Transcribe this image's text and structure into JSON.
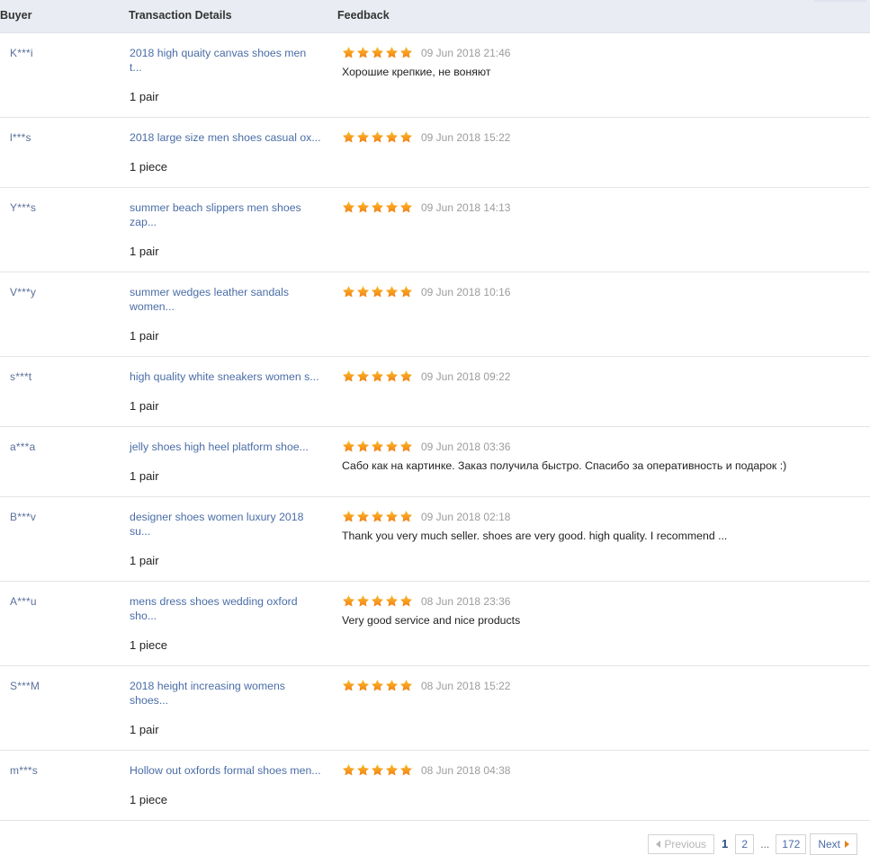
{
  "table": {
    "columns": [
      {
        "key": "buyer",
        "label": "Buyer"
      },
      {
        "key": "transaction",
        "label": "Transaction Details"
      },
      {
        "key": "feedback",
        "label": "Feedback"
      }
    ],
    "rows": [
      {
        "buyer": "K***i",
        "product": "2018 high quaity canvas shoes men t...",
        "quantity": "1 pair",
        "rating": 5,
        "date": "09 Jun 2018 21:46",
        "comment": "Хорошие крепкие, не воняют"
      },
      {
        "buyer": "l***s",
        "product": "2018 large size men shoes casual ox...",
        "quantity": "1 piece",
        "rating": 5,
        "date": "09 Jun 2018 15:22",
        "comment": ""
      },
      {
        "buyer": "Y***s",
        "product": "summer beach slippers men shoes zap...",
        "quantity": "1 pair",
        "rating": 5,
        "date": "09 Jun 2018 14:13",
        "comment": ""
      },
      {
        "buyer": "V***y",
        "product": "summer wedges leather sandals women...",
        "quantity": "1 pair",
        "rating": 5,
        "date": "09 Jun 2018 10:16",
        "comment": ""
      },
      {
        "buyer": "s***t",
        "product": "high quality white sneakers women s...",
        "quantity": "1 pair",
        "rating": 5,
        "date": "09 Jun 2018 09:22",
        "comment": ""
      },
      {
        "buyer": "a***a",
        "product": "jelly shoes high heel platform shoe...",
        "quantity": "1 pair",
        "rating": 5,
        "date": "09 Jun 2018 03:36",
        "comment": "Сабо как на картинке. Заказ получила быстро. Спасибо за оперативность и подарок :)"
      },
      {
        "buyer": "B***v",
        "product": "designer shoes women luxury 2018 su...",
        "quantity": "1 pair",
        "rating": 5,
        "date": "09 Jun 2018 02:18",
        "comment": "Thank you very much seller. shoes are very good. high quality. I recommend ..."
      },
      {
        "buyer": "A***u",
        "product": "mens dress shoes wedding oxford sho...",
        "quantity": "1 piece",
        "rating": 5,
        "date": "08 Jun 2018 23:36",
        "comment": "Very good service and nice products"
      },
      {
        "buyer": "S***M",
        "product": "2018 height increasing womens shoes...",
        "quantity": "1 pair",
        "rating": 5,
        "date": "08 Jun 2018 15:22",
        "comment": ""
      },
      {
        "buyer": "m***s",
        "product": "Hollow out oxfords formal shoes men...",
        "quantity": "1 piece",
        "rating": 5,
        "date": "08 Jun 2018 04:38",
        "comment": ""
      }
    ]
  },
  "pagination": {
    "previous_label": "Previous",
    "next_label": "Next",
    "ellipsis": "...",
    "pages": [
      "1",
      "2"
    ],
    "last_page": "172",
    "current_page": "1"
  },
  "colors": {
    "header_bg": "#e9ecf2",
    "link": "#4a6da7",
    "star": "#f5a623",
    "date": "#9c9c9c",
    "row_border": "#e4e4e4"
  },
  "icons": {
    "star": "star-icon",
    "prev_arrow": "triangle-left-icon",
    "next_arrow": "triangle-right-icon"
  }
}
